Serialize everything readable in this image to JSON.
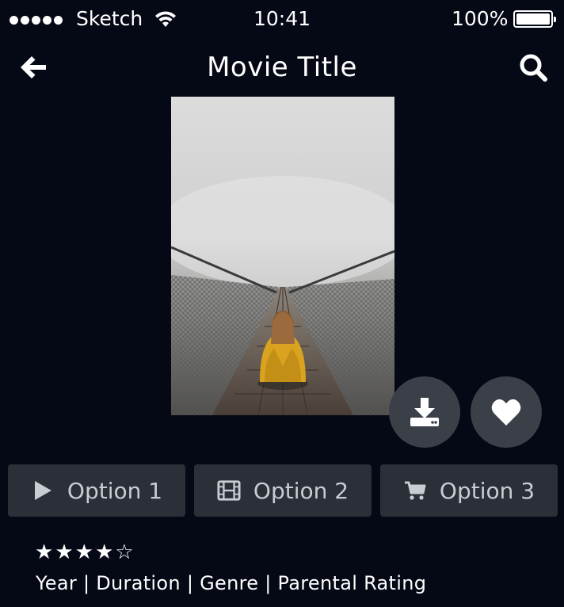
{
  "status_bar": {
    "carrier": "Sketch",
    "time": "10:41",
    "battery_percent": "100%",
    "signal_bars": 5,
    "battery_level": 1.0
  },
  "nav": {
    "title": "Movie Title",
    "back_icon": "arrow-left-icon",
    "search_icon": "search-icon"
  },
  "poster": {
    "alt": "Person in yellow jacket sitting on a foggy suspension bridge"
  },
  "actions": {
    "download_icon": "download-icon",
    "favorite_icon": "heart-icon"
  },
  "options": [
    {
      "label": "Option 1",
      "icon": "play-icon"
    },
    {
      "label": "Option 2",
      "icon": "film-icon"
    },
    {
      "label": "Option 3",
      "icon": "cart-icon"
    }
  ],
  "rating": {
    "stars": 4,
    "max": 5
  },
  "meta_line": "Year | Duration | Genre | Parental Rating",
  "colors": {
    "background": "#050815",
    "button": "#2b2f38",
    "circle_button": "#3b3f48",
    "accent_yellow": "#d9a21f"
  }
}
